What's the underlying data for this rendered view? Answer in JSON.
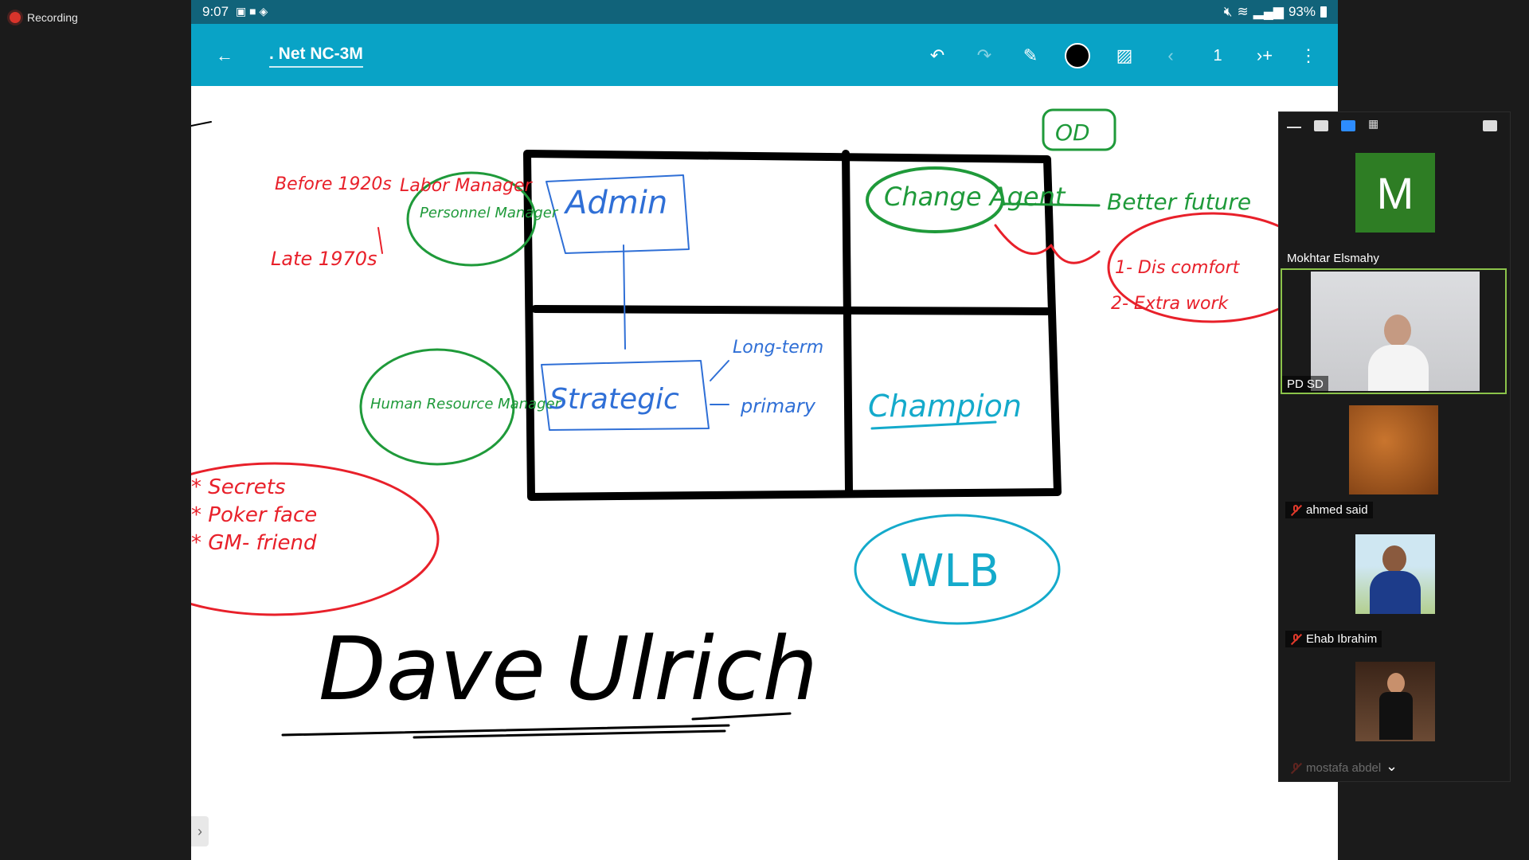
{
  "recording": {
    "label": "Recording"
  },
  "status_bar": {
    "time": "9:07",
    "battery": "93%"
  },
  "toolbar": {
    "title": ". Net NC-3M",
    "page_number": "1"
  },
  "whiteboard": {
    "top_left_lines": [
      "Before 1920s",
      "Labor Manager",
      "Late 1970s"
    ],
    "personnel_manager": "Personnel Manager",
    "admin": "Admin",
    "strategic": "Strategic",
    "long_term": "Long-term",
    "primary": "primary",
    "hr_manager": "Human Resource Manager",
    "change_agent": "Change Agent",
    "champion": "Champion",
    "od": "OD",
    "better_future": "Better future",
    "discomfort": "1- Dis comfort",
    "extra_work": "2- Extra work",
    "secrets": "* Secrets",
    "poker_face": "* Poker face",
    "gm_friend": "* GM- friend",
    "wlb": "WLB",
    "dave": "Dave",
    "ulrich": "Ulrich"
  },
  "participants": [
    {
      "name": "Mokhtar Elsmahy",
      "initial": "M",
      "muted": false
    },
    {
      "name": "PD SD",
      "muted": false,
      "active": true
    },
    {
      "name": "ahmed said",
      "muted": true
    },
    {
      "name": "Ehab Ibrahim",
      "muted": true
    },
    {
      "name": "mostafa abdel",
      "muted": true
    }
  ],
  "colors": {
    "toolbar": "#09a3c6",
    "statusbar": "#11637a",
    "red_ink": "#e8202a",
    "green_ink": "#1f9a3a",
    "blue_ink": "#2f6fd6",
    "cyan_ink": "#14aacb",
    "avatar_green": "#2e7d24"
  }
}
